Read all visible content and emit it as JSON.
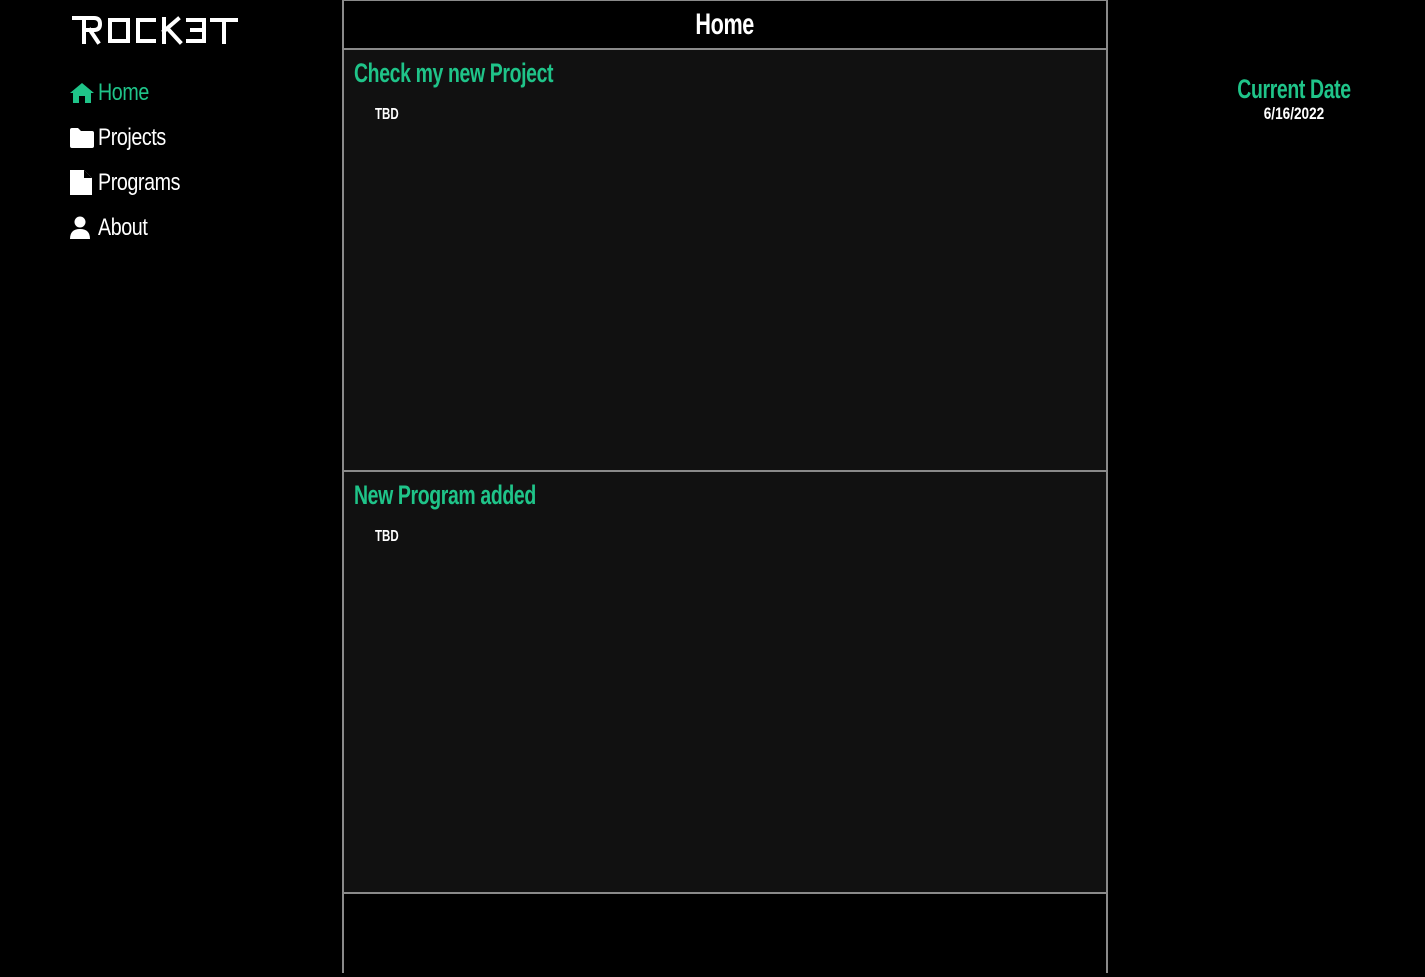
{
  "brand": {
    "logo_text": "ROCK3T"
  },
  "nav": {
    "items": [
      {
        "label": "Home",
        "icon": "home-icon",
        "active": true
      },
      {
        "label": "Projects",
        "icon": "folder-icon",
        "active": false
      },
      {
        "label": "Programs",
        "icon": "file-icon",
        "active": false
      },
      {
        "label": "About",
        "icon": "user-icon",
        "active": false
      }
    ]
  },
  "header": {
    "title": "Home"
  },
  "cards": [
    {
      "title": "Check my new Project",
      "body": "TBD"
    },
    {
      "title": "New Program added",
      "body": "TBD"
    }
  ],
  "sidebar_right": {
    "date_label": "Current Date",
    "date_value": "6/16/2022"
  },
  "colors": {
    "accent": "#1fc489",
    "background": "#000000",
    "card_background": "#111111",
    "border": "#8a8a8a",
    "text": "#ffffff"
  }
}
